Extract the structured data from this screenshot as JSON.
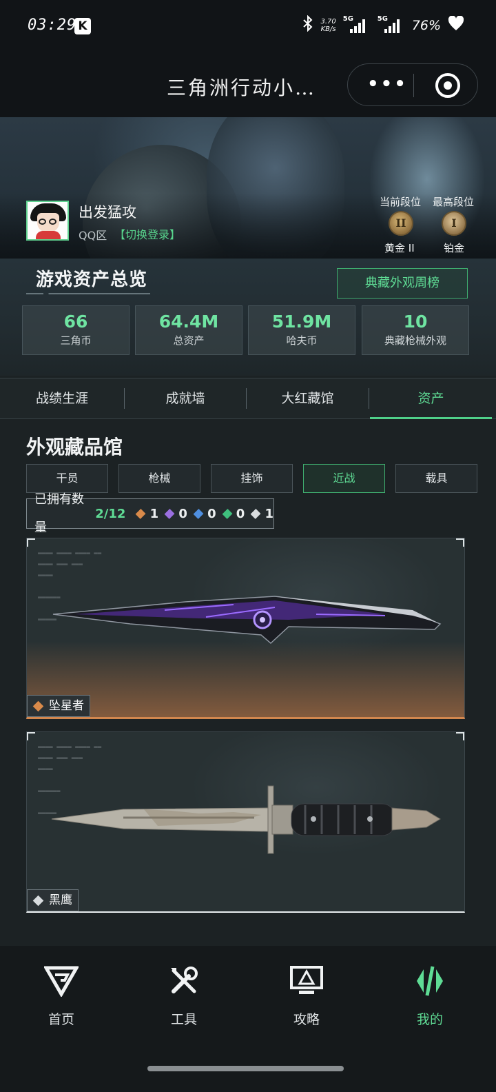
{
  "status_bar": {
    "time": "03:29",
    "k_badge": "K",
    "net_speed_value": "3.70",
    "net_speed_unit": "KB/s",
    "sig1_label": "5G",
    "sig2_label": "5G",
    "battery": "76%"
  },
  "title_bar": {
    "title": "三角洲行动小…"
  },
  "profile": {
    "username": "出发猛攻",
    "region": "QQ区",
    "switch_login": "【切换登录】",
    "current_rank_label": "当前段位",
    "current_rank_name": "黄金 II",
    "current_rank_numeral": "II",
    "highest_rank_label": "最高段位",
    "highest_rank_name": "铂金",
    "highest_rank_numeral": "I"
  },
  "overview": {
    "title": "游戏资产总览",
    "ranking_button": "典藏外观周榜",
    "stats": [
      {
        "value": "66",
        "label": "三角币"
      },
      {
        "value": "64.4M",
        "label": "总资产"
      },
      {
        "value": "51.9M",
        "label": "哈夫币"
      },
      {
        "value": "10",
        "label": "典藏枪械外观"
      }
    ]
  },
  "tabs": [
    {
      "label": "战绩生涯"
    },
    {
      "label": "成就墙"
    },
    {
      "label": "大红藏馆"
    },
    {
      "label": "资产"
    }
  ],
  "active_tab": "资产",
  "gallery": {
    "title": "外观藏品馆",
    "filters": [
      {
        "label": "干员"
      },
      {
        "label": "枪械"
      },
      {
        "label": "挂饰"
      },
      {
        "label": "近战"
      },
      {
        "label": "载具"
      }
    ],
    "active_filter": "近战",
    "owned_label": "已拥有数量",
    "owned_count": "2/12",
    "rarity_counts": [
      {
        "color": "#d98a4a",
        "count": "1"
      },
      {
        "color": "#9a6fe0",
        "count": "0"
      },
      {
        "color": "#4f8fe0",
        "count": "0"
      },
      {
        "color": "#3fc07e",
        "count": "0"
      },
      {
        "color": "#d8dcde",
        "count": "1"
      }
    ],
    "items": [
      {
        "name": "坠星者",
        "rarity_color": "#d98a4a"
      },
      {
        "name": "黑鹰",
        "rarity_color": "#d8dcde"
      }
    ]
  },
  "bottom_nav": [
    {
      "label": "首页",
      "icon": "home-logo-icon"
    },
    {
      "label": "工具",
      "icon": "tools-icon"
    },
    {
      "label": "攻略",
      "icon": "guide-monitor-icon"
    },
    {
      "label": "我的",
      "icon": "profile-logo-icon"
    }
  ],
  "active_nav": "我的",
  "colors": {
    "accent_green": "#5fdc95",
    "background": "#1c2224",
    "orange_rarity": "#d98a4a"
  }
}
